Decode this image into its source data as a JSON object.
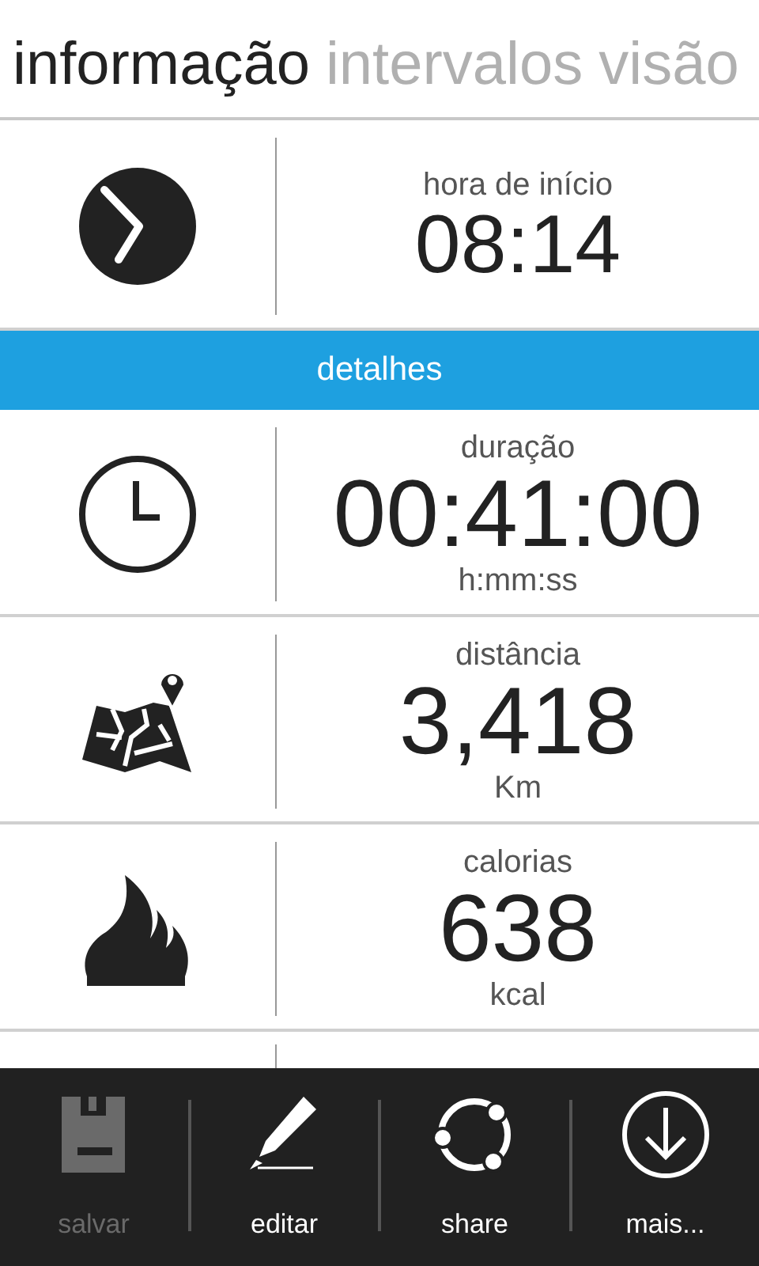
{
  "tabs": [
    {
      "label": "informação",
      "selected": true
    },
    {
      "label": "intervalos",
      "selected": false
    },
    {
      "label": "visão",
      "selected": false
    }
  ],
  "rows": [
    {
      "kind": "time",
      "label": "hora de início",
      "value": "08:14"
    },
    {
      "kind": "section",
      "label": "detalhes"
    },
    {
      "kind": "duration",
      "label": "duração",
      "value": "00:41:00",
      "unit": "h:mm:ss"
    },
    {
      "kind": "distance",
      "label": "distância",
      "value": "3,418",
      "unit": "Km"
    },
    {
      "kind": "energy",
      "label": "calorias",
      "value": "638",
      "unit": "kcal"
    }
  ],
  "app_bar": [
    {
      "kind": "save",
      "label": "salvar",
      "disabled": true
    },
    {
      "kind": "edit",
      "label": "editar",
      "disabled": false
    },
    {
      "kind": "share",
      "label": "share",
      "disabled": false
    },
    {
      "kind": "more",
      "label": "mais...",
      "disabled": false
    }
  ]
}
